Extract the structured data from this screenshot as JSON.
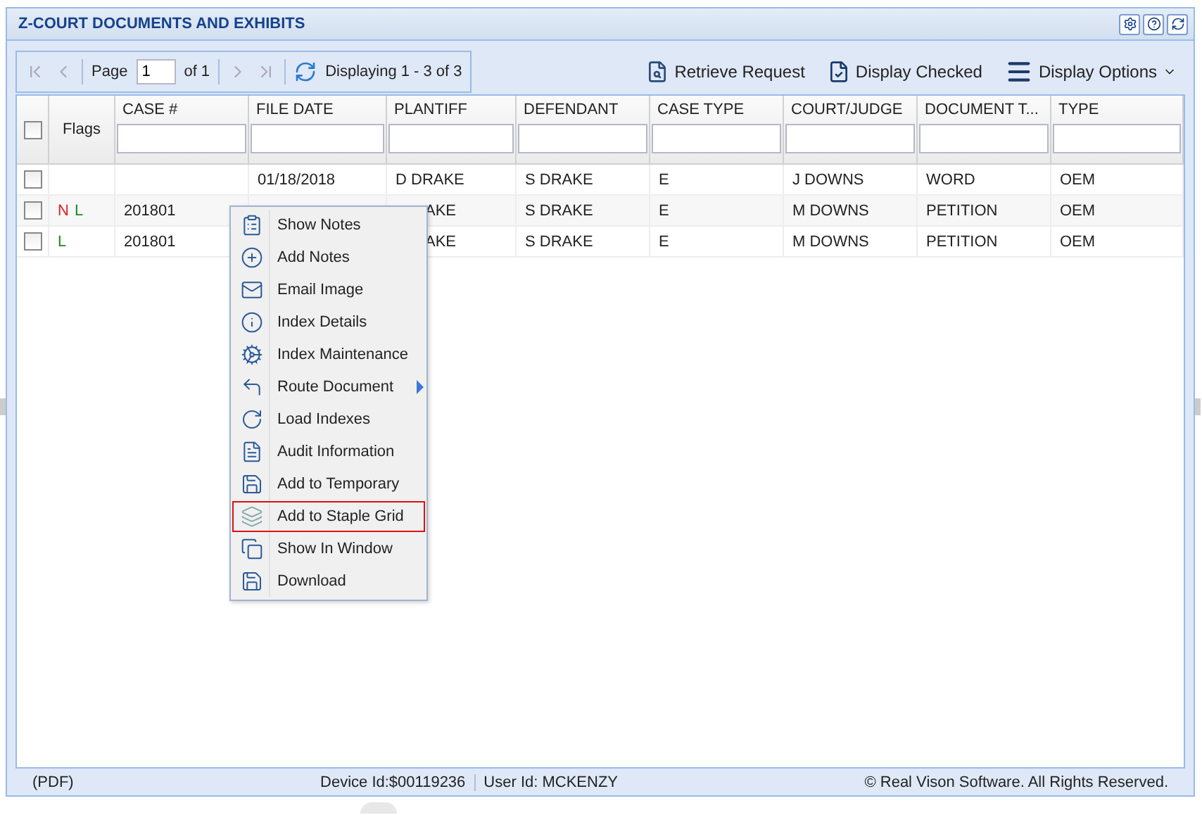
{
  "window": {
    "title": "Z-COURT DOCUMENTS AND EXHIBITS"
  },
  "pager": {
    "page_label": "Page",
    "page": "1",
    "of": "of 1",
    "display": "Displaying 1 - 3 of 3"
  },
  "toolbar_buttons": [
    {
      "label": "Retrieve Request",
      "kind": "retrieve"
    },
    {
      "label": "Display Checked",
      "kind": "checked"
    },
    {
      "label": "Display Options",
      "kind": "options"
    }
  ],
  "table": {
    "flags_header": "Flags",
    "select_all": false,
    "columns": [
      "CASE #",
      "FILE DATE",
      "PLANTIFF",
      "DEFENDANT",
      "CASE TYPE",
      "COURT/JUDGE",
      "DOCUMENT T...",
      "TYPE"
    ],
    "rows": [
      {
        "checked": false,
        "flags": [],
        "cells": [
          "",
          "01/18/2018",
          "D DRAKE",
          "S DRAKE",
          "E",
          "J DOWNS",
          "WORD",
          "OEM"
        ]
      },
      {
        "checked": false,
        "flags": [
          {
            "text": "N",
            "color": "#e02020"
          },
          {
            "text": "L",
            "color": "#1e8a1e"
          }
        ],
        "cells": [
          "201801",
          "",
          "AKE",
          "S DRAKE",
          "E",
          "M DOWNS",
          "PETITION",
          "OEM"
        ],
        "covered": true
      },
      {
        "checked": false,
        "flags": [
          {
            "text": "L",
            "color": "#1e8a1e"
          }
        ],
        "cells": [
          "201801",
          "",
          "AKE",
          "S DRAKE",
          "E",
          "M DOWNS",
          "PETITION",
          "OEM"
        ],
        "covered": true
      }
    ]
  },
  "context_menu": [
    {
      "label": "Show Notes",
      "kind": "notes",
      "selected": false
    },
    {
      "label": "Add Notes",
      "kind": "add",
      "selected": false
    },
    {
      "label": "Email Image",
      "kind": "mail",
      "selected": false
    },
    {
      "label": "Index Details",
      "kind": "info",
      "selected": false
    },
    {
      "label": "Index Maintenance",
      "kind": "maint",
      "selected": false
    },
    {
      "label": "Route Document",
      "kind": "route",
      "selected": false,
      "submenu": true
    },
    {
      "label": "Load Indexes",
      "kind": "load",
      "selected": false
    },
    {
      "label": "Audit Information",
      "kind": "audit",
      "selected": false
    },
    {
      "label": "Add to Temporary",
      "kind": "save",
      "selected": false
    },
    {
      "label": "Add to Staple Grid",
      "kind": "staple",
      "selected": true
    },
    {
      "label": "Show In Window",
      "kind": "window",
      "selected": false
    },
    {
      "label": "Download",
      "kind": "save",
      "selected": false
    }
  ],
  "status_bar": {
    "format": "(PDF)",
    "device": "Device Id:$00119236",
    "user": "User Id: MCKENZY",
    "copyright": "© Real Vison Software. All Rights Reserved."
  }
}
